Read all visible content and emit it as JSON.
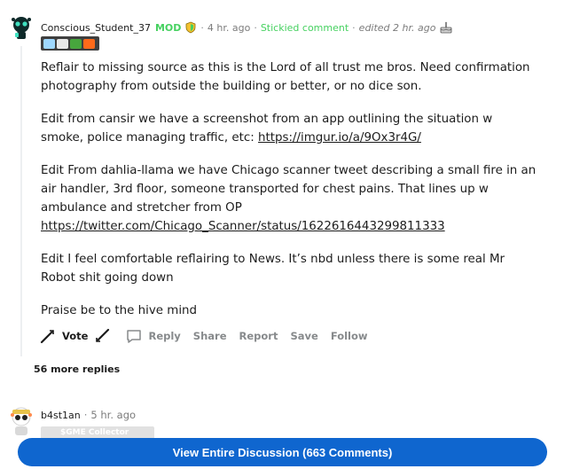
{
  "comment": {
    "author": "Conscious_Student_37",
    "mod_badge": "MOD",
    "time": "4 hr. ago",
    "stickied": "Stickied comment",
    "edited": "edited 2 hr. ago",
    "paragraphs": [
      "Reflair to missing source as this is the Lord of all trust me bros. Need confirmation photography from outside the building or better, or no dice son.",
      "Edit from cansir we have a screenshot from an app outlining the situation w smoke, police managing traffic, etc: ",
      "Edit From dahlia-llama we have Chicago scanner tweet describing a small fire in an air handler, 3rd floor, someone transported for chest pains. That lines up w ambulance and stretcher from OP",
      "Edit I feel comfortable reflairing to News. It’s nbd unless there is some real Mr Robot shit going down",
      "Praise be to the hive mind"
    ],
    "link1": "https://imgur.io/a/9Ox3r4G/",
    "link2": "https://twitter.com/Chicago_Scanner/status/1622616443299811333",
    "actions": {
      "vote": "Vote",
      "reply": "Reply",
      "share": "Share",
      "report": "Report",
      "save": "Save",
      "follow": "Follow"
    },
    "more_replies": "56 more replies"
  },
  "next_comment": {
    "author": "b4st1an",
    "time": "5 hr. ago",
    "flair": "$GME Collector"
  },
  "view_button": "View Entire Discussion (663 Comments)",
  "colors": {
    "mod_green": "#46d160",
    "button_blue": "#0f66cf",
    "flair_bg": "#3f3f3f"
  }
}
